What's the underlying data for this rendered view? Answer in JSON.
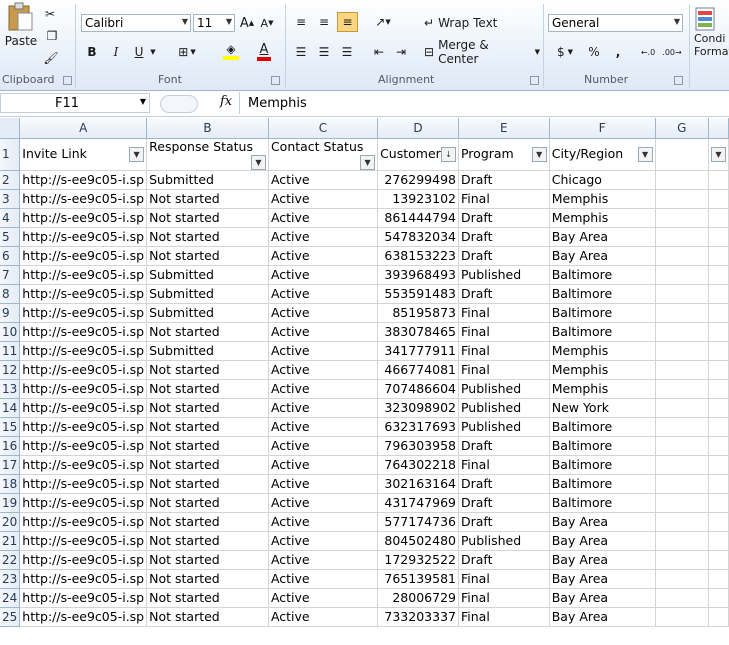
{
  "ribbon": {
    "clipboard": {
      "label": "Clipboard",
      "paste": "Paste"
    },
    "font": {
      "label": "Font",
      "name": "Calibri",
      "size": "11",
      "bold": "B",
      "italic": "I",
      "underline": "U"
    },
    "alignment": {
      "label": "Alignment",
      "wrap_text": "Wrap Text",
      "merge_center": "Merge & Center"
    },
    "number": {
      "label": "Number",
      "format": "General",
      "currency": "$",
      "percent": "%",
      "comma": ","
    },
    "styles": {
      "cond_format_line1": "Condi",
      "cond_format_line2": "Format"
    }
  },
  "formula_bar": {
    "name_box": "F11",
    "fx": "fx",
    "content": "Memphis"
  },
  "grid": {
    "columns": [
      "A",
      "B",
      "C",
      "D",
      "E",
      "F",
      "G"
    ],
    "headers": [
      "Invite Link",
      "Response Status",
      "Contact Status",
      "Customer",
      "Program",
      "City/Region"
    ],
    "rows": [
      [
        "http://s-ee9c05-i.sp",
        "Submitted",
        "Active",
        "276299498",
        "Draft",
        "Chicago"
      ],
      [
        "http://s-ee9c05-i.sp",
        "Not started",
        "Active",
        "13923102",
        "Final",
        "Memphis"
      ],
      [
        "http://s-ee9c05-i.sp",
        "Not started",
        "Active",
        "861444794",
        "Draft",
        "Memphis"
      ],
      [
        "http://s-ee9c05-i.sp",
        "Not started",
        "Active",
        "547832034",
        "Draft",
        "Bay Area"
      ],
      [
        "http://s-ee9c05-i.sp",
        "Not started",
        "Active",
        "638153223",
        "Draft",
        "Bay Area"
      ],
      [
        "http://s-ee9c05-i.sp",
        "Submitted",
        "Active",
        "393968493",
        "Published",
        "Baltimore"
      ],
      [
        "http://s-ee9c05-i.sp",
        "Submitted",
        "Active",
        "553591483",
        "Draft",
        "Baltimore"
      ],
      [
        "http://s-ee9c05-i.sp",
        "Submitted",
        "Active",
        "85195873",
        "Final",
        "Baltimore"
      ],
      [
        "http://s-ee9c05-i.sp",
        "Not started",
        "Active",
        "383078465",
        "Final",
        "Baltimore"
      ],
      [
        "http://s-ee9c05-i.sp",
        "Submitted",
        "Active",
        "341777911",
        "Final",
        "Memphis"
      ],
      [
        "http://s-ee9c05-i.sp",
        "Not started",
        "Active",
        "466774081",
        "Final",
        "Memphis"
      ],
      [
        "http://s-ee9c05-i.sp",
        "Not started",
        "Active",
        "707486604",
        "Published",
        "Memphis"
      ],
      [
        "http://s-ee9c05-i.sp",
        "Not started",
        "Active",
        "323098902",
        "Published",
        "New York"
      ],
      [
        "http://s-ee9c05-i.sp",
        "Not started",
        "Active",
        "632317693",
        "Published",
        "Baltimore"
      ],
      [
        "http://s-ee9c05-i.sp",
        "Not started",
        "Active",
        "796303958",
        "Draft",
        "Baltimore"
      ],
      [
        "http://s-ee9c05-i.sp",
        "Not started",
        "Active",
        "764302218",
        "Final",
        "Baltimore"
      ],
      [
        "http://s-ee9c05-i.sp",
        "Not started",
        "Active",
        "302163164",
        "Draft",
        "Baltimore"
      ],
      [
        "http://s-ee9c05-i.sp",
        "Not started",
        "Active",
        "431747969",
        "Draft",
        "Baltimore"
      ],
      [
        "http://s-ee9c05-i.sp",
        "Not started",
        "Active",
        "577174736",
        "Draft",
        "Bay Area"
      ],
      [
        "http://s-ee9c05-i.sp",
        "Not started",
        "Active",
        "804502480",
        "Published",
        "Bay Area"
      ],
      [
        "http://s-ee9c05-i.sp",
        "Not started",
        "Active",
        "172932522",
        "Draft",
        "Bay Area"
      ],
      [
        "http://s-ee9c05-i.sp",
        "Not started",
        "Active",
        "765139581",
        "Final",
        "Bay Area"
      ],
      [
        "http://s-ee9c05-i.sp",
        "Not started",
        "Active",
        "28006729",
        "Final",
        "Bay Area"
      ],
      [
        "http://s-ee9c05-i.sp",
        "Not started",
        "Active",
        "733203337",
        "Final",
        "Bay Area"
      ]
    ]
  },
  "colors": {
    "ribbon_border": "#9fb4d2",
    "header_bg": "#e4ecf7",
    "highlight": "#f8d57e"
  }
}
